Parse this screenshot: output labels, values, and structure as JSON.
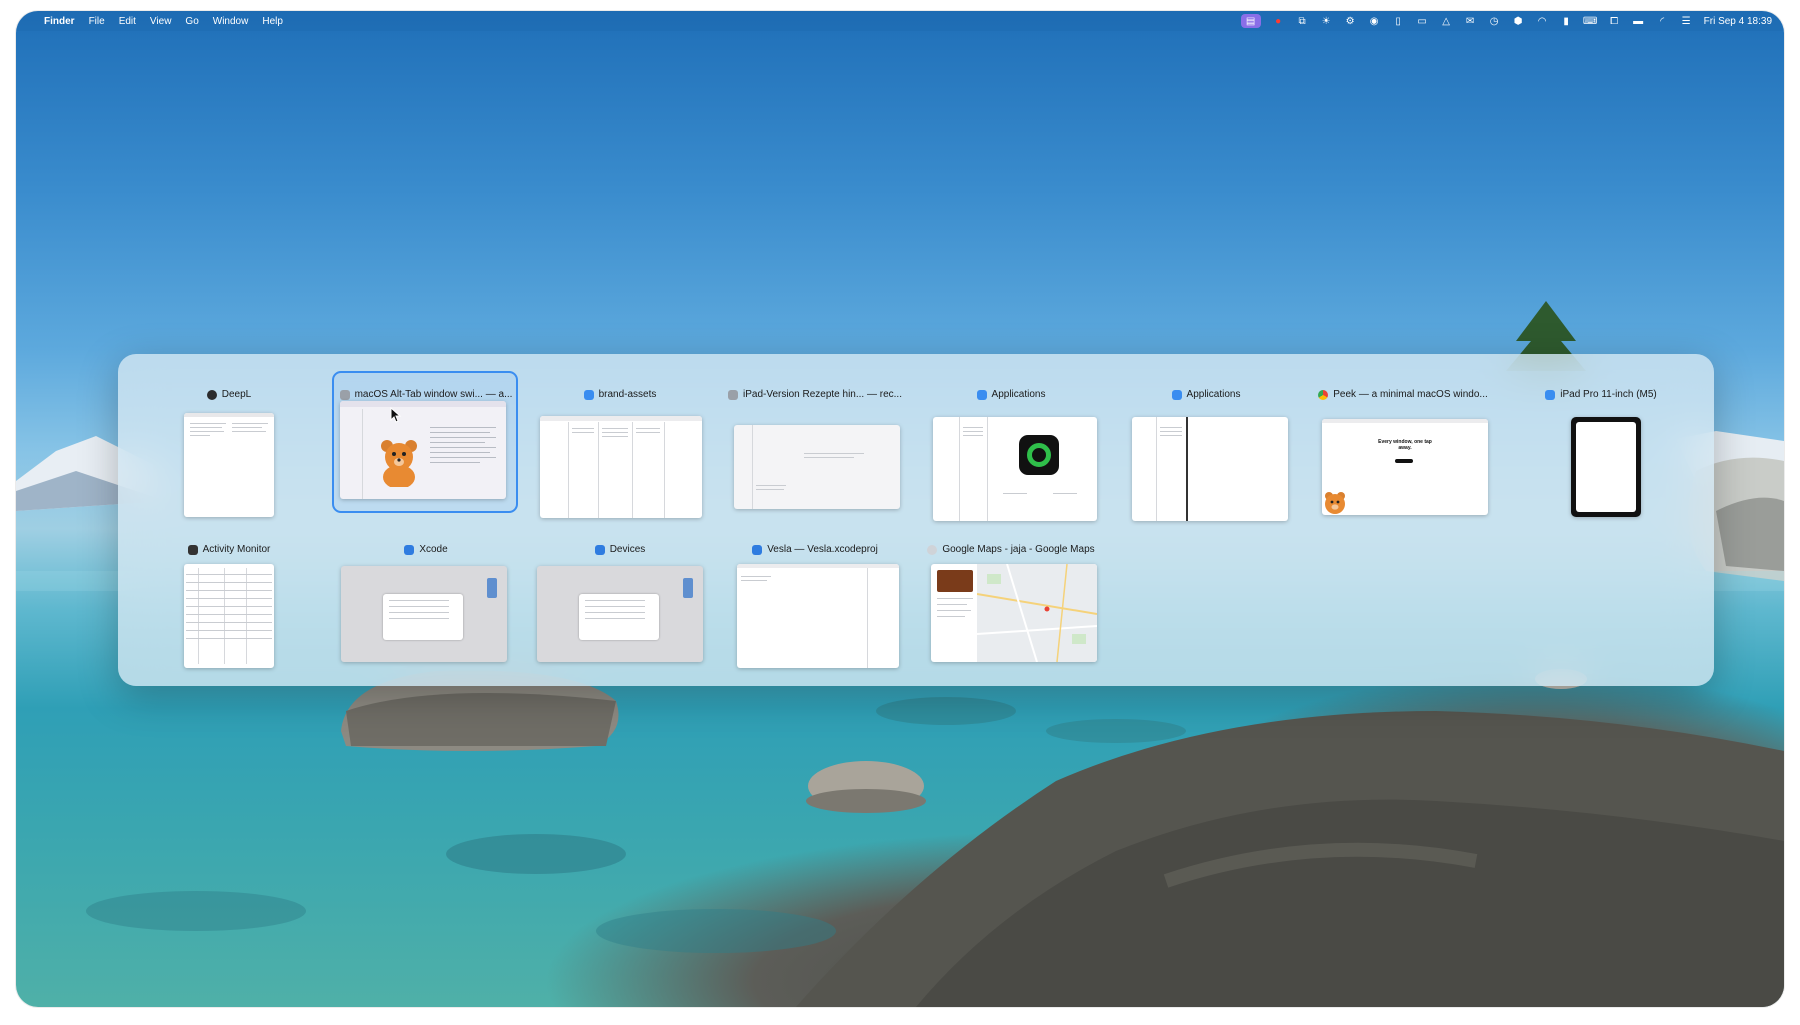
{
  "menubar": {
    "app": "Finder",
    "items": [
      "File",
      "Edit",
      "View",
      "Go",
      "Window",
      "Help"
    ],
    "clock": "Fri Sep 4  18:39"
  },
  "switcher": {
    "row1": [
      {
        "title": "DeepL",
        "icon_color": "#2c2c2e"
      },
      {
        "title": "macOS Alt-Tab window swi... — a...",
        "icon_color": "#9aa0a8",
        "selected": true
      },
      {
        "title": "brand-assets",
        "icon_color": "#3a8df0"
      },
      {
        "title": "iPad-Version Rezepte hin... — rec...",
        "icon_color": "#9aa0a8"
      },
      {
        "title": "Applications",
        "icon_color": "#3a8df0"
      },
      {
        "title": "Applications",
        "icon_color": "#3a8df0"
      },
      {
        "title": "Peek — a minimal macOS windo...",
        "icon_color": "#e94235"
      },
      {
        "title": "iPad Pro 11-inch (M5)",
        "icon_color": "#3a8df0"
      }
    ],
    "row2": [
      {
        "title": "Activity Monitor",
        "icon_color": "#333333"
      },
      {
        "title": "Xcode",
        "icon_color": "#2f7ce0"
      },
      {
        "title": "Devices",
        "icon_color": "#2f7ce0"
      },
      {
        "title": "Vesla — Vesla.xcodeproj",
        "icon_color": "#2f7ce0"
      },
      {
        "title": "Google Maps - jaja - Google Maps",
        "icon_color": "#cfd3d8"
      }
    ],
    "peek_text": "Every window, one tap away."
  }
}
